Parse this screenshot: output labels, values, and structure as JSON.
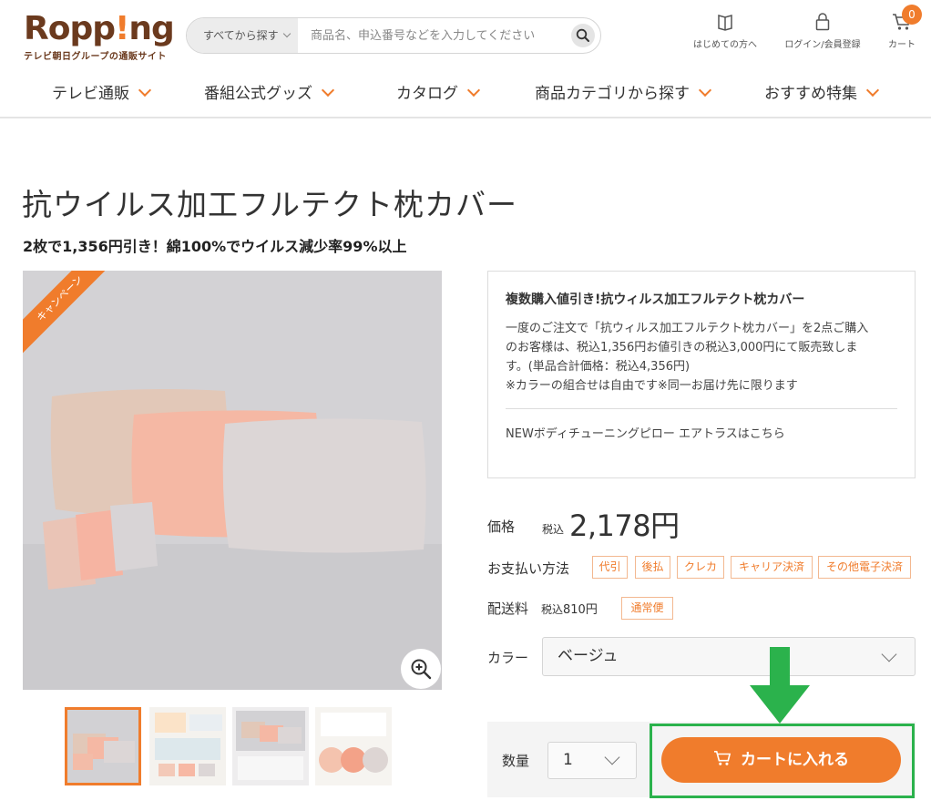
{
  "header": {
    "logo_text_main": "Ropp",
    "logo_text_bang": "!",
    "logo_text_end": "ng",
    "logo_sub": "テレビ朝日グループの通販サイト",
    "search_scope": "すべてから探す",
    "search_placeholder": "商品名、申込番号などを入力してください",
    "icons": [
      {
        "label": "はじめての方へ",
        "icon": "book-icon"
      },
      {
        "label": "ログイン/会員登録",
        "icon": "lock-icon"
      },
      {
        "label": "カート",
        "icon": "cart-icon"
      }
    ],
    "cart_count": "0"
  },
  "nav": [
    {
      "label": "テレビ通販"
    },
    {
      "label": "番組公式グッズ"
    },
    {
      "label": "カタログ"
    },
    {
      "label": "商品カテゴリから探す"
    },
    {
      "label": "おすすめ特集"
    }
  ],
  "product": {
    "title": "抗ウイルス加工フルテクト枕カバー",
    "subtitle": "2枚で1,356円引き！綿100%でウイルス減少率99%以上",
    "ribbon": "キャンペーン",
    "info": {
      "title": "複数購入値引き!抗ウィルス加工フルテクト枕カバー",
      "body_lines": [
        "一度のご注文で「抗ウィルス加工フルテクト枕カバー」を2点ご購入",
        "のお客様は、税込1,356円お値引きの税込3,000円にて販売致しま",
        "す。(単品合計価格：税込4,356円)",
        "※カラーの組合せは自由です※同一お届け先に限ります"
      ],
      "link": "NEWボディチューニングピロー エアトラスはこちら"
    },
    "price_label": "価格",
    "price_tax": "税込",
    "price_value": "2,178円",
    "payment_label": "お支払い方法",
    "payment_methods": [
      "代引",
      "後払",
      "クレカ",
      "キャリア決済",
      "その他電子決済"
    ],
    "shipping_label": "配送料",
    "shipping_tax": "税込",
    "shipping_value": "810円",
    "shipping_type": "通常便",
    "color_label": "カラー",
    "color_value": "ベージュ",
    "qty_label": "数量",
    "qty_value": "1",
    "cart_button": "カートに入れる"
  },
  "colors": {
    "accent": "#f07c2c",
    "brand": "#6b3a1e",
    "highlight": "#2bb24c"
  }
}
